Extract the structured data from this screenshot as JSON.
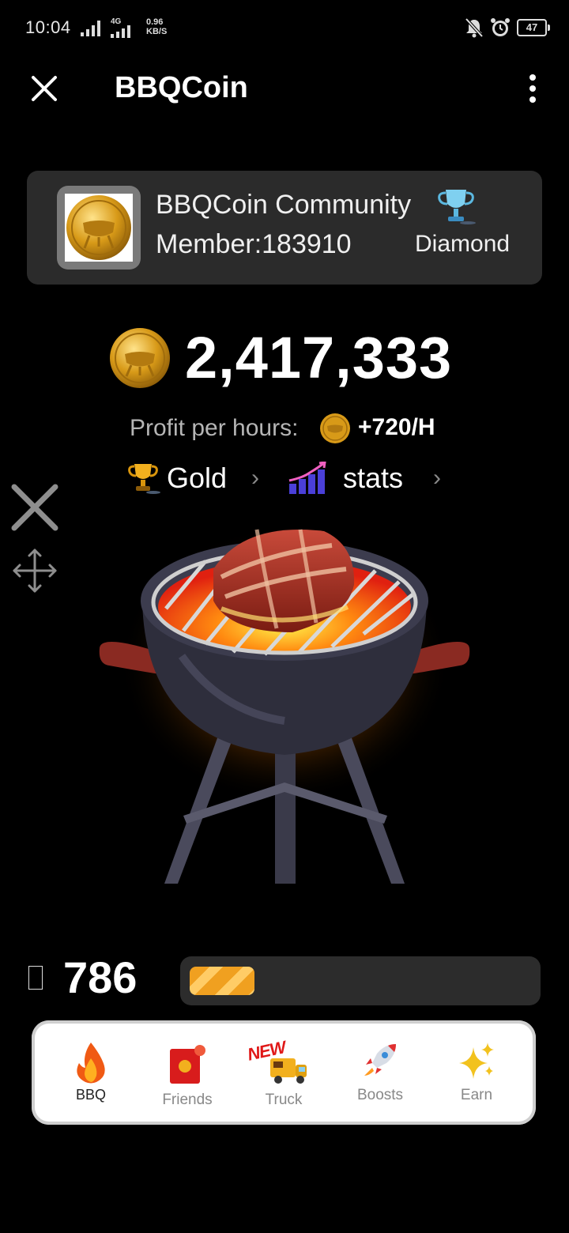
{
  "status_bar": {
    "time": "10:04",
    "network_type": "4G",
    "speed_value": "0.96",
    "speed_unit": "KB/S",
    "battery": "47"
  },
  "app_bar": {
    "title": "BBQCoin"
  },
  "community": {
    "name": "BBQCoin Community",
    "member": "Member:183910",
    "rank": "Diamond"
  },
  "balance": {
    "amount": "2,417,333",
    "profit_label": "Profit per hours",
    "profit_value": "+720/H"
  },
  "level": {
    "name": "Gold",
    "stats_label": "stats"
  },
  "energy": {
    "value": "786",
    "fill_fraction": 0.19
  },
  "nav": {
    "items": [
      {
        "label": "BBQ",
        "icon": "fire-icon",
        "active": true
      },
      {
        "label": "Friends",
        "icon": "red-envelope-icon",
        "active": false
      },
      {
        "label": "Truck",
        "icon": "truck-icon",
        "badge": "NEW",
        "active": false
      },
      {
        "label": "Boosts",
        "icon": "rocket-icon",
        "active": false
      },
      {
        "label": "Earn",
        "icon": "sparkles-icon",
        "active": false
      }
    ]
  },
  "colors": {
    "background": "#000000",
    "card": "#2b2b2b",
    "coin_gold": "#e0a81e",
    "energy_fill": "#f0a020",
    "nav_active": "#222222",
    "nav_inactive": "#888888"
  }
}
